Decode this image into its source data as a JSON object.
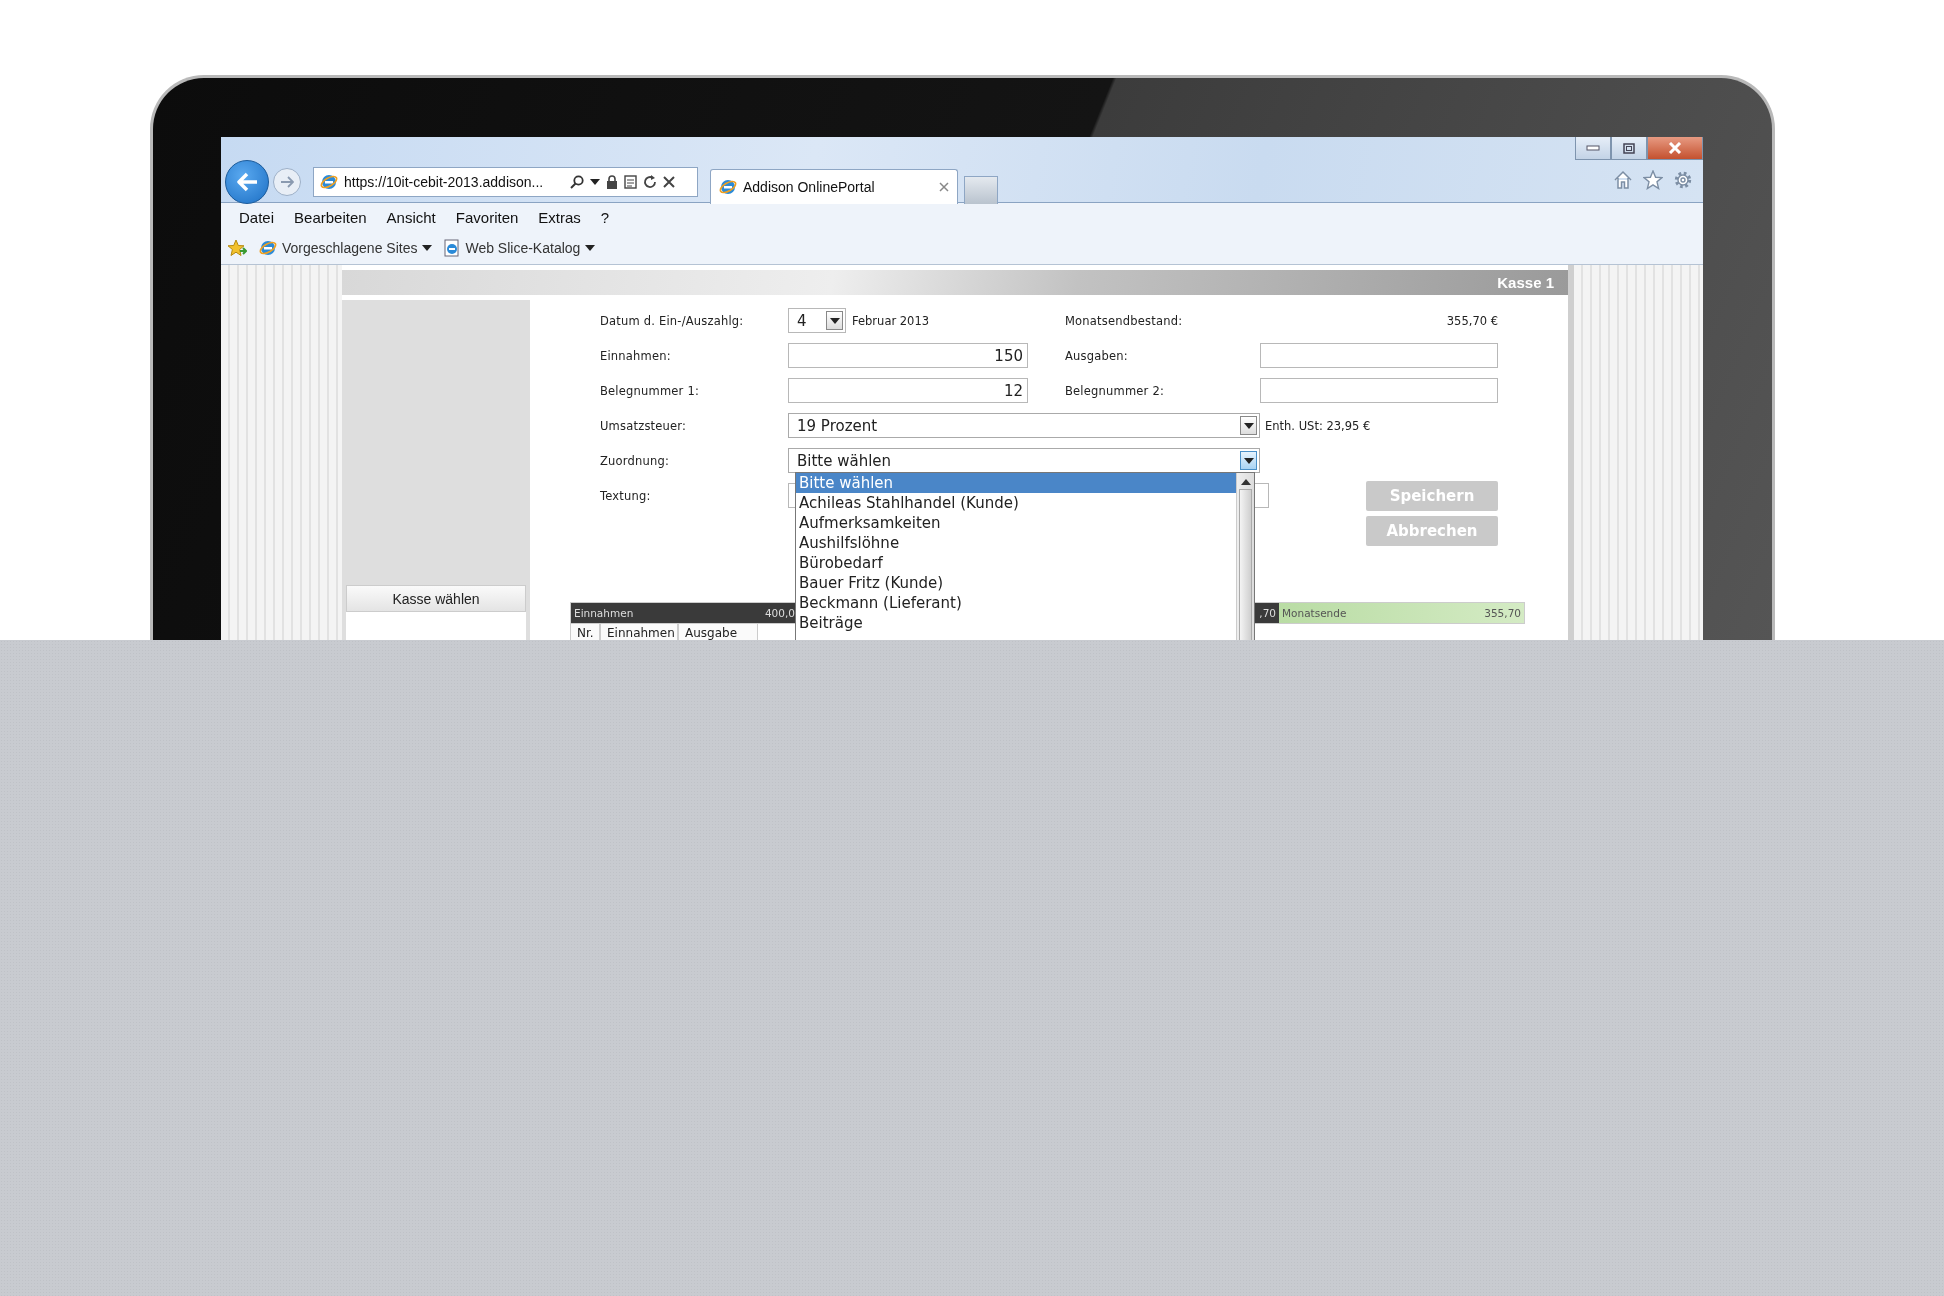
{
  "browser": {
    "address": "https://10it-cebit-2013.addison...",
    "tabs": [
      {
        "label": "Addison OnlinePortal",
        "selected": true
      }
    ],
    "menu": [
      "Datei",
      "Bearbeiten",
      "Ansicht",
      "Favoriten",
      "Extras",
      "?"
    ],
    "favorites": [
      "Vorgeschlagene Sites",
      "Web Slice-Katalog"
    ]
  },
  "page": {
    "header": "Kasse 1",
    "sidebar": {
      "title": "Kasse wählen"
    },
    "form": {
      "left": [
        {
          "label": "Datum d. Ein-/Auszahlg:",
          "kind": "day",
          "value": "4",
          "suffix": "Februar 2013"
        },
        {
          "label": "Einnahmen:",
          "kind": "text",
          "value": "150"
        },
        {
          "label": "Belegnummer 1:",
          "kind": "text",
          "value": "12"
        },
        {
          "label": "Umsatzsteuer:",
          "kind": "select",
          "value": "19 Prozent",
          "expanded": false,
          "note": "Enth. USt: 23,95 €"
        },
        {
          "label": "Zuordnung:",
          "kind": "select",
          "value": "Bitte wählen",
          "expanded": true,
          "options": [
            {
              "label": "Bitte wählen",
              "selected": true
            },
            {
              "label": "Achileas Stahlhandel (Kunde)",
              "selected": false
            },
            {
              "label": "Aufmerksamkeiten",
              "selected": false
            },
            {
              "label": "Aushilfslöhne",
              "selected": false
            },
            {
              "label": "Bürobedarf",
              "selected": false
            },
            {
              "label": "Bauer Fritz (Kunde)",
              "selected": false
            },
            {
              "label": "Beckmann (Lieferant)",
              "selected": false
            },
            {
              "label": "Beiträge",
              "selected": false
            }
          ]
        },
        {
          "label": "Textung:",
          "kind": "text"
        }
      ],
      "right": [
        {
          "label": "Monatsendbestand:",
          "kind": "readout",
          "value": "355,70 €"
        },
        {
          "label": "Ausgaben:",
          "kind": "text"
        },
        {
          "label": "Belegnummer 2:",
          "kind": "text"
        }
      ],
      "buttons": [
        {
          "label": "Speichern",
          "disabled": true
        },
        {
          "label": "Abbrechen",
          "disabled": true
        }
      ]
    },
    "table": {
      "bars": [
        {
          "label": "Einnahmen",
          "value": "400,0",
          "kind": "sum"
        },
        {
          "value": ",70",
          "kind": "sum"
        },
        {
          "label": "Monatsende",
          "value": "355,70",
          "kind": "balance"
        }
      ],
      "columns": [
        "Nr.",
        "Einnahmen",
        "Ausgabe"
      ]
    }
  }
}
